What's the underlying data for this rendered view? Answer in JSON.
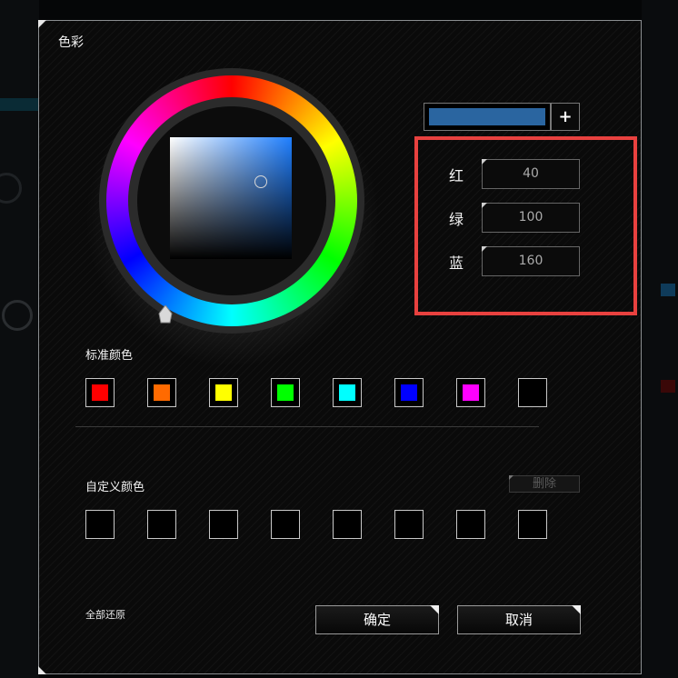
{
  "dialog": {
    "title": "色彩"
  },
  "preview": {
    "color": "#2a65a0",
    "add_label": "+"
  },
  "rgb": {
    "red_label": "红",
    "green_label": "绿",
    "blue_label": "蓝",
    "red_value": "40",
    "green_value": "100",
    "blue_value": "160"
  },
  "standard_colors": {
    "label": "标准颜色",
    "swatches": [
      "#ff0000",
      "#ff6a00",
      "#ffff00",
      "#00ff00",
      "#00ffff",
      "#0000ff",
      "#ff00ff",
      "none"
    ]
  },
  "custom_colors": {
    "label": "自定义颜色",
    "delete_label": "删除",
    "swatches": [
      "none",
      "none",
      "none",
      "none",
      "none",
      "none",
      "none",
      "none"
    ]
  },
  "footer": {
    "reset_label": "全部还原",
    "confirm_label": "确定",
    "cancel_label": "取消"
  },
  "colors": {
    "highlight": "#e8413f"
  }
}
